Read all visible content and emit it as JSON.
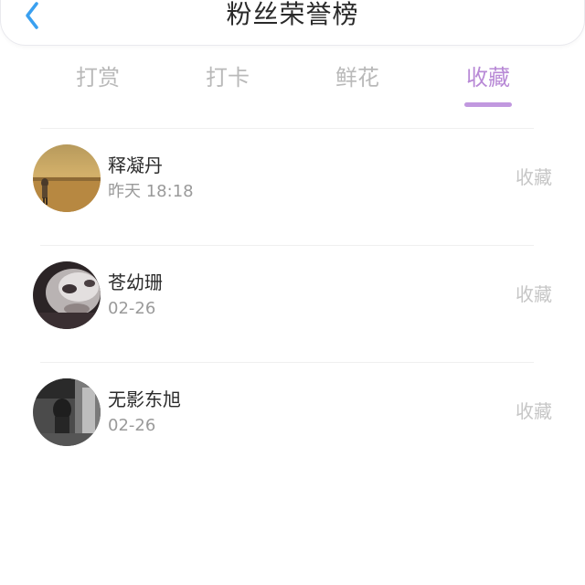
{
  "header": {
    "title": "粉丝荣誉榜",
    "back_icon": "chevron-left-icon",
    "accent_color": "#3aa0f0"
  },
  "tabs": [
    {
      "label": "打赏",
      "active": false
    },
    {
      "label": "打卡",
      "active": false
    },
    {
      "label": "鲜花",
      "active": false
    },
    {
      "label": "收藏",
      "active": true
    }
  ],
  "tab_active_color": "#b889d6",
  "fans": [
    {
      "name": "释凝丹",
      "time": "昨天 18:18",
      "action": "收藏",
      "avatar": "desert-figure-avatar"
    },
    {
      "name": "苍幼珊",
      "time": "02-26",
      "action": "收藏",
      "avatar": "face-closeup-avatar"
    },
    {
      "name": "无影东旭",
      "time": "02-26",
      "action": "收藏",
      "avatar": "dark-photo-avatar"
    }
  ]
}
